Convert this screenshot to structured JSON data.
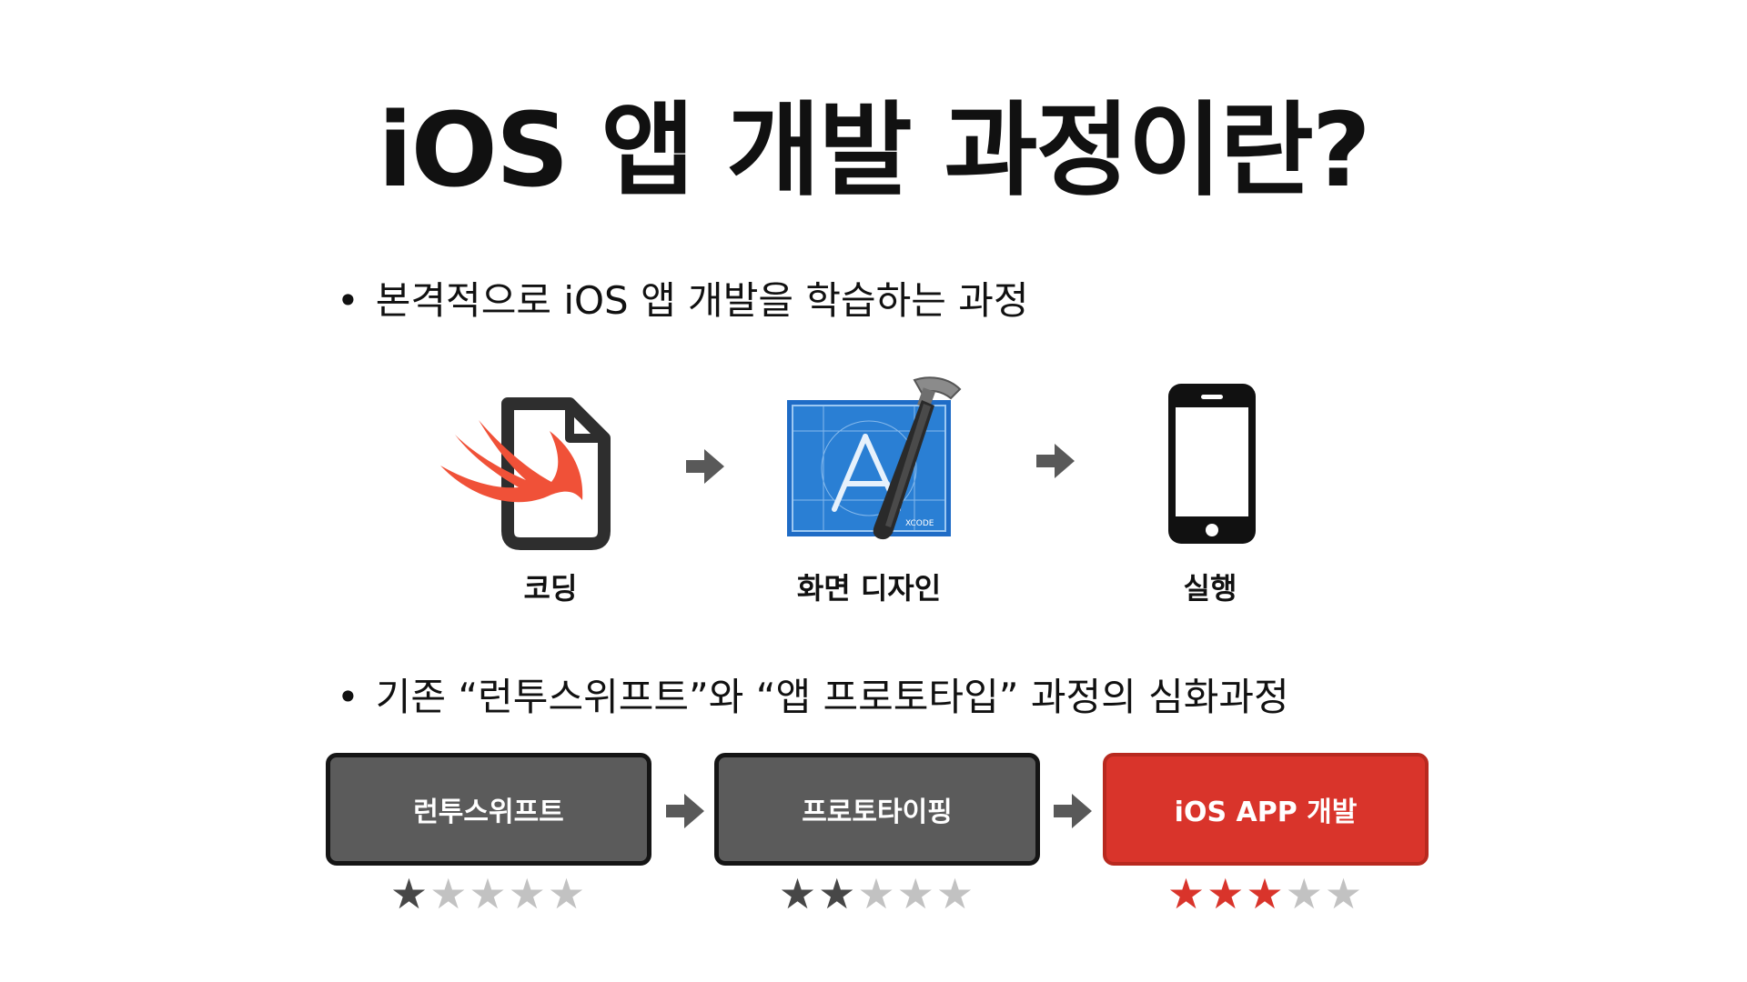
{
  "title": "iOS 앱 개발 과정이란?",
  "bullets": [
    "본격적으로 iOS 앱 개발을 학습하는 과정",
    "기존 “런투스위프트”와 “앱 프로토타입” 과정의 심화과정"
  ],
  "bullet_glyph": "•",
  "steps": [
    {
      "label": "코딩",
      "icon": "swift-file-icon"
    },
    {
      "label": "화면 디자인",
      "icon": "xcode-icon",
      "icon_text": "XCODE"
    },
    {
      "label": "실행",
      "icon": "iphone-icon"
    }
  ],
  "courses": [
    {
      "label": "런투스위프트",
      "rating": 1,
      "max": 5,
      "color": "#5b5b5b"
    },
    {
      "label": "프로토타이핑",
      "rating": 2,
      "max": 5,
      "color": "#5b5b5b"
    },
    {
      "label": "iOS APP 개발",
      "rating": 3,
      "max": 5,
      "color": "#d9342b"
    }
  ],
  "colors": {
    "accent": "#d9342b",
    "box_dark": "#5b5b5b",
    "arrow": "#595959",
    "swift_orange": "#f05138",
    "xcode_blue": "#2a7fd4"
  }
}
